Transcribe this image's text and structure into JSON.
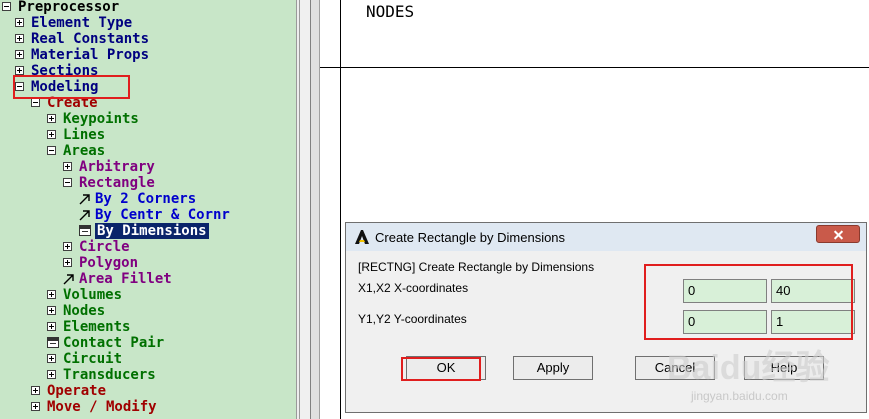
{
  "tree": {
    "preprocessor": "Preprocessor",
    "element_type": "Element Type",
    "real_constants": "Real Constants",
    "material_props": "Material Props",
    "sections": "Sections",
    "modeling": "Modeling",
    "create": "Create",
    "keypoints": "Keypoints",
    "lines": "Lines",
    "areas": "Areas",
    "arbitrary": "Arbitrary",
    "rectangle": "Rectangle",
    "by_2_corners": "By 2 Corners",
    "by_centr_cornr": "By Centr & Cornr",
    "by_dimensions": "By Dimensions",
    "circle": "Circle",
    "polygon": "Polygon",
    "area_fillet": "Area Fillet",
    "volumes": "Volumes",
    "nodes": "Nodes",
    "elements": "Elements",
    "contact_pair": "Contact Pair",
    "circuit": "Circuit",
    "transducers": "Transducers",
    "operate": "Operate",
    "move_modify": "Move / Modify"
  },
  "output": {
    "text": "NODES"
  },
  "dialog": {
    "title": "Create Rectangle by Dimensions",
    "command_label": "[RECTNG]  Create Rectangle by Dimensions",
    "x_label": "X1,X2  X-coordinates",
    "y_label": "Y1,Y2  Y-coordinates",
    "x1": "0",
    "x2": "40",
    "y1": "0",
    "y2": "1",
    "ok_label": "OK",
    "apply_label": "Apply",
    "cancel_label": "Cancel",
    "help_label": "Help"
  },
  "watermark": {
    "text": "Baidu经验",
    "sub": "jingyan.baidu.com"
  },
  "colors": {
    "tree_bg": "#c8e6c8",
    "field_bg": "#d8f0d8",
    "highlight": "#e01e1e",
    "selection": "#0a246a"
  }
}
